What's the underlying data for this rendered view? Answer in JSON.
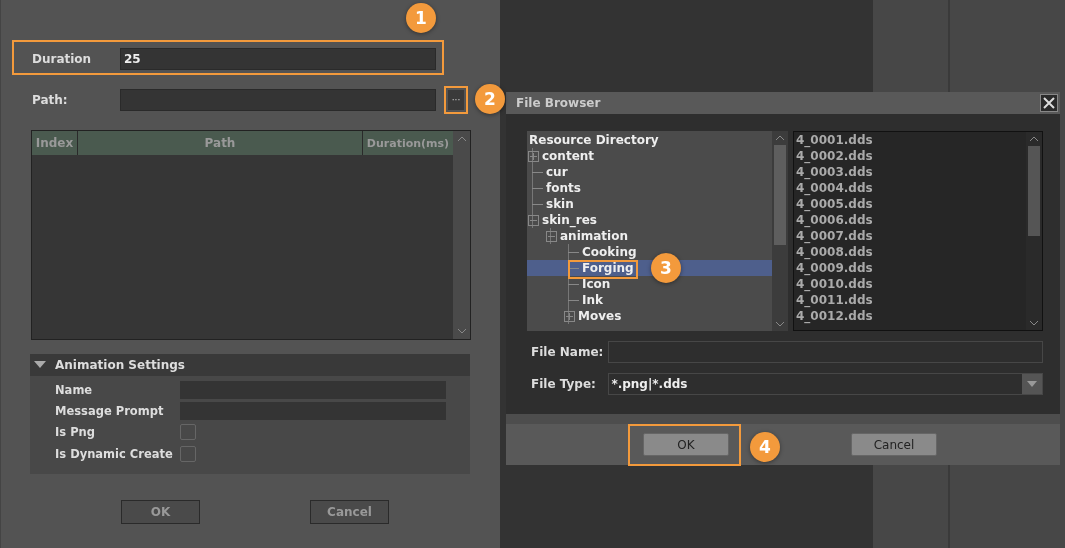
{
  "form": {
    "duration": {
      "label": "Duration",
      "value": "25"
    },
    "path": {
      "label": "Path:",
      "browse_button": "···"
    },
    "table": {
      "columns": [
        "Index",
        "Path",
        "Duration(ms)"
      ]
    },
    "settings": {
      "title": "Animation Settings",
      "expanded": true,
      "rows": [
        {
          "kind": "text",
          "label": "Name"
        },
        {
          "kind": "text",
          "label": "Message Prompt"
        },
        {
          "kind": "checkbox",
          "label": "Is Png",
          "checked": false
        },
        {
          "kind": "checkbox",
          "label": "Is Dynamic Create",
          "checked": false
        }
      ]
    },
    "buttons": [
      "OK",
      "Cancel"
    ]
  },
  "file_browser": {
    "title": "File Browser",
    "tree": {
      "label": "Resource Directory",
      "children": [
        {
          "label": "content",
          "expanded": false,
          "selected": false
        },
        {
          "label": "cur",
          "selected": false
        },
        {
          "label": "fonts",
          "selected": false
        },
        {
          "label": "skin",
          "selected": false
        },
        {
          "label": "skin_res",
          "expanded": true,
          "selected": false,
          "children": [
            {
              "label": "animation",
              "expanded": true,
              "selected": false,
              "children": [
                {
                  "label": "Cooking",
                  "selected": false
                },
                {
                  "label": "Forging",
                  "selected": true
                },
                {
                  "label": "Icon",
                  "selected": false
                },
                {
                  "label": "Ink",
                  "selected": false
                },
                {
                  "label": "Moves",
                  "expanded": false,
                  "selected": false
                }
              ]
            }
          ]
        }
      ]
    },
    "files": [
      "4_0001.dds",
      "4_0002.dds",
      "4_0003.dds",
      "4_0004.dds",
      "4_0005.dds",
      "4_0006.dds",
      "4_0007.dds",
      "4_0008.dds",
      "4_0009.dds",
      "4_0010.dds",
      "4_0011.dds",
      "4_0012.dds"
    ],
    "file_name": {
      "label": "File Name:"
    },
    "file_type": {
      "label": "File Type:",
      "value": "*.png|*.dds"
    },
    "buttons": [
      "OK",
      "Cancel"
    ]
  },
  "callouts": [
    {
      "label": "1"
    },
    {
      "label": "2"
    },
    {
      "label": "3"
    },
    {
      "label": "4"
    }
  ]
}
